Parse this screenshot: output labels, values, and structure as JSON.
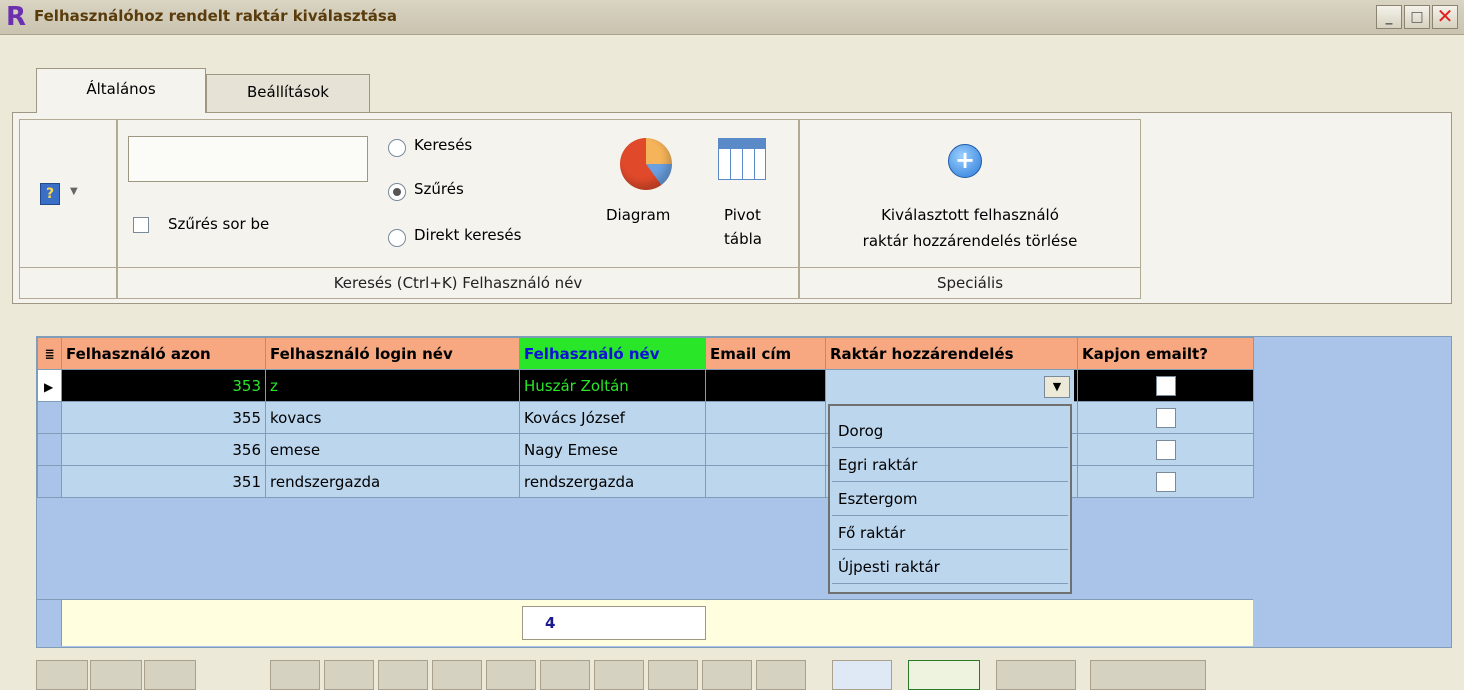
{
  "window": {
    "title": "Felhasználóhoz rendelt raktár kiválasztása",
    "logo": "R",
    "minimize": "_",
    "maximize": "□",
    "close": "✕"
  },
  "tabs": [
    {
      "label": "Általános"
    },
    {
      "label": "Beállítások"
    }
  ],
  "ribbon": {
    "help_dropdown": "?",
    "search": {
      "value": "",
      "filter_row_label": "Szűrés sor be",
      "filter_row_checked": false,
      "modes": [
        {
          "label": "Keresés",
          "selected": false
        },
        {
          "label": "Szűrés",
          "selected": true
        },
        {
          "label": "Direkt keresés",
          "selected": false
        }
      ],
      "group_label": "Keresés (Ctrl+K) Felhasználó név"
    },
    "diagram_label": "Diagram",
    "pivot_label_1": "Pivot",
    "pivot_label_2": "tábla",
    "special": {
      "action_line1": "Kiválasztott felhasználó",
      "action_line2": "raktár hozzárendelés törlése",
      "group_label": "Speciális"
    }
  },
  "grid": {
    "columns": [
      "Felhasználó azon",
      "Felhasználó login név",
      "Felhasználó név",
      "Email cím",
      "Raktár hozzárendelés",
      "Kapjon emailt?"
    ],
    "rows": [
      {
        "id": "353",
        "login": "z",
        "name": "Huszár Zoltán",
        "email": "",
        "warehouse": "",
        "send_email": false
      },
      {
        "id": "355",
        "login": "kovacs",
        "name": "Kovács József",
        "email": "",
        "warehouse": "",
        "send_email": false
      },
      {
        "id": "356",
        "login": "emese",
        "name": "Nagy Emese",
        "email": "",
        "warehouse": "",
        "send_email": false
      },
      {
        "id": "351",
        "login": "rendszergazda",
        "name": "rendszergazda",
        "email": "",
        "warehouse": "",
        "send_email": false
      }
    ],
    "footer_count": "4"
  },
  "dropdown": {
    "options": [
      "Dorog",
      "Egri raktár",
      "Esztergom",
      "Fő raktár",
      "Újpesti raktár"
    ]
  },
  "colors": {
    "header": "#f7a880",
    "highlight_header": "#29e629",
    "row": "#bcd6ee",
    "grid_bg": "#a9c4e8"
  }
}
